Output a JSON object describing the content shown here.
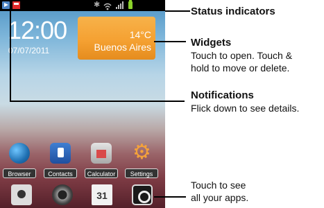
{
  "statusbar": {
    "icons": [
      "play-notification-icon",
      "flag-notification-icon",
      "bluetooth-icon",
      "wifi-icon",
      "signal-icon",
      "battery-icon"
    ]
  },
  "widget": {
    "time": "12:00",
    "date": "07/07/2011",
    "temperature": "14°C",
    "city": "Buenos Aires"
  },
  "apps": [
    {
      "label": "Browser",
      "icon": "globe-icon"
    },
    {
      "label": "Contacts",
      "icon": "contacts-icon"
    },
    {
      "label": "Calculator",
      "icon": "calculator-icon"
    },
    {
      "label": "Settings",
      "icon": "gear-icon"
    }
  ],
  "dock": {
    "calendar_day": "31",
    "items": [
      "camera-icon",
      "recorder-icon",
      "calendar-icon",
      "all-apps-icon"
    ]
  },
  "callouts": {
    "status_title": "Status indicators",
    "widgets_title": "Widgets",
    "widgets_line1": "Touch to open. Touch &",
    "widgets_line2": "hold to move or delete.",
    "notifications_title": "Notifications",
    "notifications_line1": "Flick down to see details.",
    "apps_line1": "Touch to see",
    "apps_line2": "all your apps."
  },
  "colors": {
    "weather_orange": "#f5a132",
    "battery_green": "#8bd22a",
    "settings_orange": "#f5a23a"
  }
}
